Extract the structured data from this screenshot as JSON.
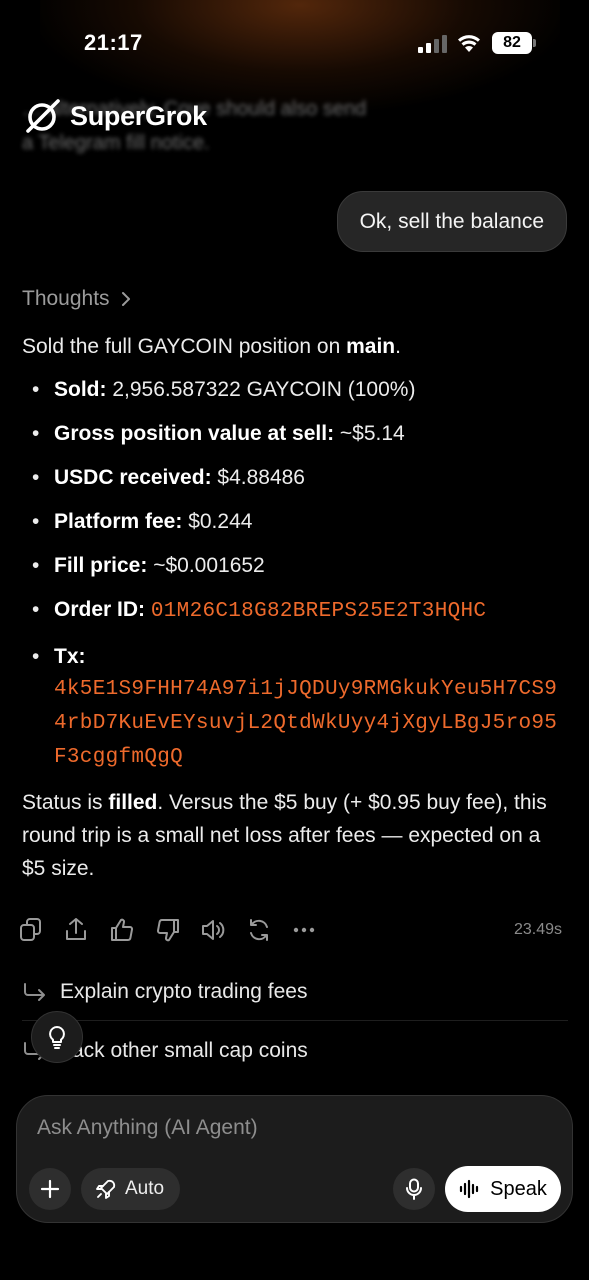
{
  "status_bar": {
    "time": "21:17",
    "battery": "82"
  },
  "header": {
    "brand": "SuperGrok",
    "prev_text_line1": "… alternatively, Cove should also send",
    "prev_text_line2": "a Telegram fill notice."
  },
  "user_message": "Ok, sell the balance",
  "assistant": {
    "thoughts_label": "Thoughts",
    "intro_pre": "Sold the full GAYCOIN position on ",
    "intro_bold": "main",
    "intro_post": ".",
    "items": [
      {
        "label": "Sold:",
        "value": " 2,956.587322 GAYCOIN (100%)"
      },
      {
        "label": "Gross position value at sell:",
        "value": " ~$5.14"
      },
      {
        "label": "USDC received:",
        "value": " $4.88486"
      },
      {
        "label": "Platform fee:",
        "value": " $0.244"
      },
      {
        "label": "Fill price:",
        "value": " ~$0.001652"
      },
      {
        "label": "Order ID:",
        "code": "01M26C18G82BREPS25E2T3HQHC"
      },
      {
        "label": "Tx:",
        "code": "4k5E1S9FHH74A97i1jJQDUy9RMGkukYeu5H7CS94rbD7KuEvEYsuvjL2QtdWkUyy4jXgyLBgJ5ro95F3cggfmQgQ"
      }
    ],
    "status_pre": "Status is ",
    "status_bold": "filled",
    "status_post": ". Versus the $5 buy (+ $0.95 buy fee), this round trip is a small net loss after fees — expected on a $5 size."
  },
  "actions": {
    "duration": "23.49s"
  },
  "suggestions": [
    {
      "label": "Explain crypto trading fees"
    },
    {
      "label": "ack other small cap coins"
    }
  ],
  "composer": {
    "placeholder": "Ask Anything (AI Agent)",
    "mode_label": "Auto",
    "speak_label": "Speak"
  },
  "colors": {
    "code": "#ee6a2c",
    "background": "#000000",
    "bubble": "#262626"
  }
}
